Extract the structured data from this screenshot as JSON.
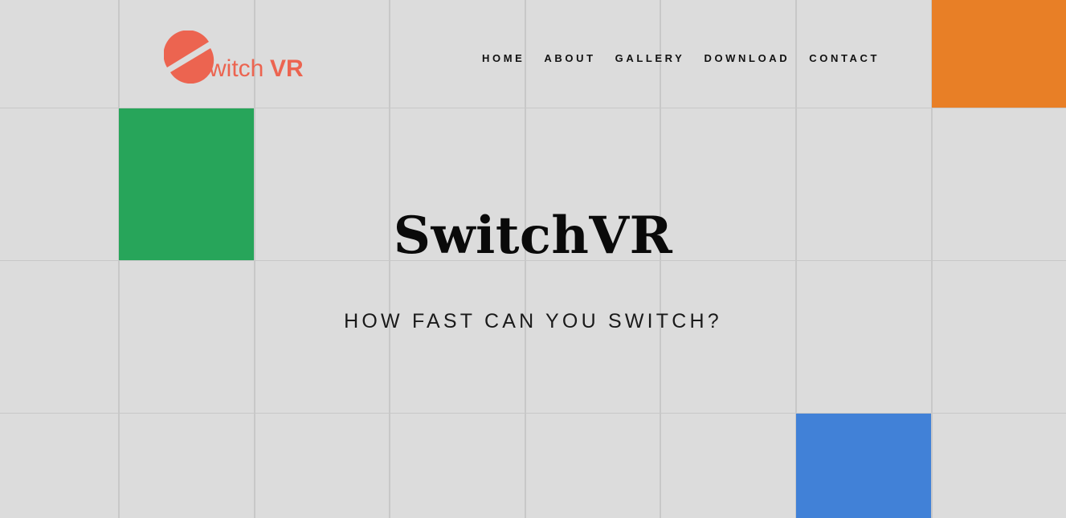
{
  "brand": {
    "logo_text_light": "witch",
    "logo_text_bold": "VR",
    "logo_color": "#ec6450",
    "icon": "switchvr-logo-icon"
  },
  "nav": {
    "items": [
      {
        "label": "HOME"
      },
      {
        "label": "ABOUT"
      },
      {
        "label": "GALLERY"
      },
      {
        "label": "DOWNLOAD"
      },
      {
        "label": "CONTACT"
      }
    ]
  },
  "hero": {
    "title": "SwitchVR",
    "subtitle": "HOW FAST CAN YOU SWITCH?"
  },
  "colors": {
    "background": "#dcdcdc",
    "grid_line": "#c8c8c8",
    "tile_green": "#27a55a",
    "tile_orange": "#e87f26",
    "tile_blue": "#4181d7",
    "text": "#0a0a0a"
  }
}
